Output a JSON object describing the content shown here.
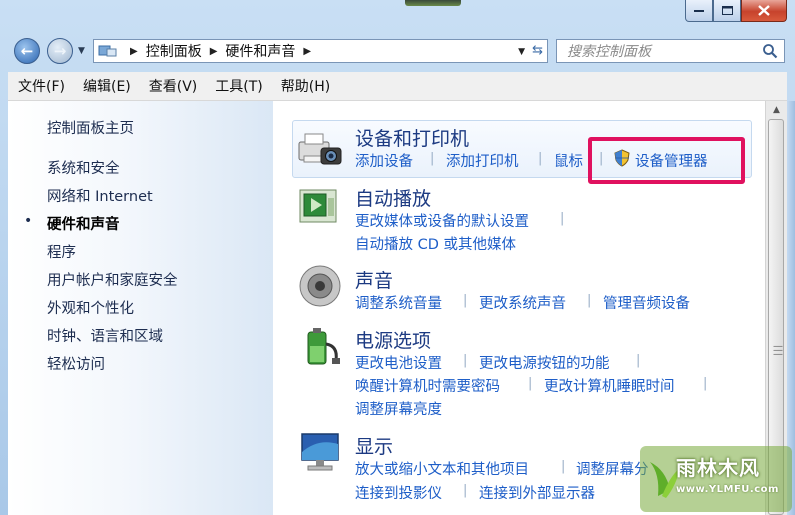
{
  "window": {
    "caption": {
      "minimize": "—",
      "maximize": "☐",
      "close": "✕"
    }
  },
  "navigation": {
    "back_glyph": "←",
    "forward_glyph": "→",
    "breadcrumb": [
      "控制面板",
      "硬件和声音"
    ],
    "search_placeholder": "搜索控制面板"
  },
  "menubar": [
    {
      "label": "文件(F)"
    },
    {
      "label": "编辑(E)"
    },
    {
      "label": "查看(V)"
    },
    {
      "label": "工具(T)"
    },
    {
      "label": "帮助(H)"
    }
  ],
  "sidebar": {
    "home": "控制面板主页",
    "items": [
      {
        "label": "系统和安全",
        "active": false
      },
      {
        "label": "网络和 Internet",
        "active": false
      },
      {
        "label": "硬件和声音",
        "active": true
      },
      {
        "label": "程序",
        "active": false
      },
      {
        "label": "用户帐户和家庭安全",
        "active": false
      },
      {
        "label": "外观和个性化",
        "active": false
      },
      {
        "label": "时钟、语言和区域",
        "active": false
      },
      {
        "label": "轻松访问",
        "active": false
      }
    ],
    "bullet": "•"
  },
  "categories": [
    {
      "title": "设备和打印机",
      "icon": "printer-camera-icon",
      "links": [
        "添加设备",
        "添加打印机",
        "鼠标",
        "设备管理器"
      ]
    },
    {
      "title": "自动播放",
      "icon": "autoplay-icon",
      "links": [
        "更改媒体或设备的默认设置",
        "自动播放 CD 或其他媒体"
      ]
    },
    {
      "title": "声音",
      "icon": "speaker-icon",
      "links": [
        "调整系统音量",
        "更改系统声音",
        "管理音频设备"
      ]
    },
    {
      "title": "电源选项",
      "icon": "battery-power-icon",
      "links": [
        "更改电池设置",
        "更改电源按钮的功能",
        "唤醒计算机时需要密码",
        "更改计算机睡眠时间",
        "调整屏幕亮度"
      ]
    },
    {
      "title": "显示",
      "icon": "monitor-icon",
      "links": [
        "放大或缩小文本和其他项目",
        "调整屏幕分",
        "连接到投影仪",
        "连接到外部显示器"
      ]
    }
  ],
  "watermark": {
    "text": "雨林木风",
    "url": "www.YLMFU.com"
  },
  "colors": {
    "link": "#1e5ec8",
    "title": "#1c3a82",
    "highlight": "#e0115f",
    "frame": "#b9d3ee"
  }
}
